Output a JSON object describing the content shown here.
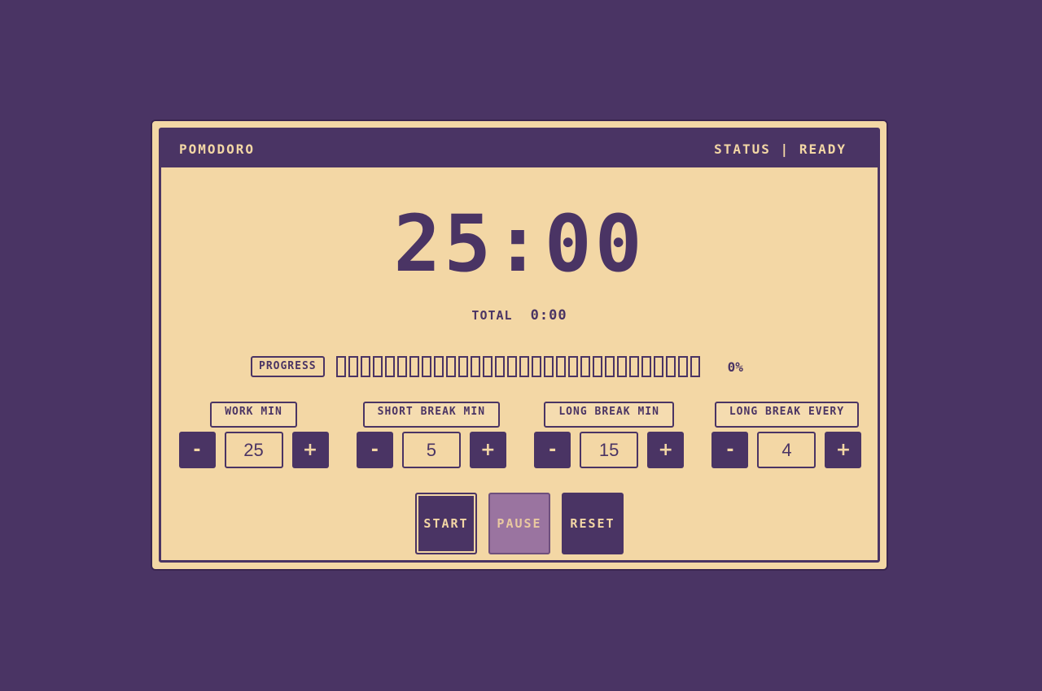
{
  "app": {
    "title": "POMODORO",
    "status_label": "STATUS",
    "status_separator": "|",
    "status_value": "READY"
  },
  "timer": {
    "display": "25:00",
    "total_label": "TOTAL",
    "total_value": "0:00"
  },
  "progress": {
    "label": "PROGRESS",
    "percent_text": "0%",
    "fraction": 0,
    "segment_count": 30
  },
  "settings": [
    {
      "label": "WORK MIN",
      "value": "25",
      "minus": "-",
      "plus": "+"
    },
    {
      "label": "SHORT BREAK MIN",
      "value": "5",
      "minus": "-",
      "plus": "+"
    },
    {
      "label": "LONG BREAK MIN",
      "value": "15",
      "minus": "-",
      "plus": "+"
    },
    {
      "label": "LONG BREAK EVERY",
      "value": "4",
      "minus": "-",
      "plus": "+"
    }
  ],
  "actions": {
    "start": "START",
    "pause": "PAUSE",
    "reset": "RESET"
  },
  "colors": {
    "background": "#4a3464",
    "panel": "#f3d7a5",
    "accent": "#4a3464",
    "disabled": "#9a74a0"
  }
}
